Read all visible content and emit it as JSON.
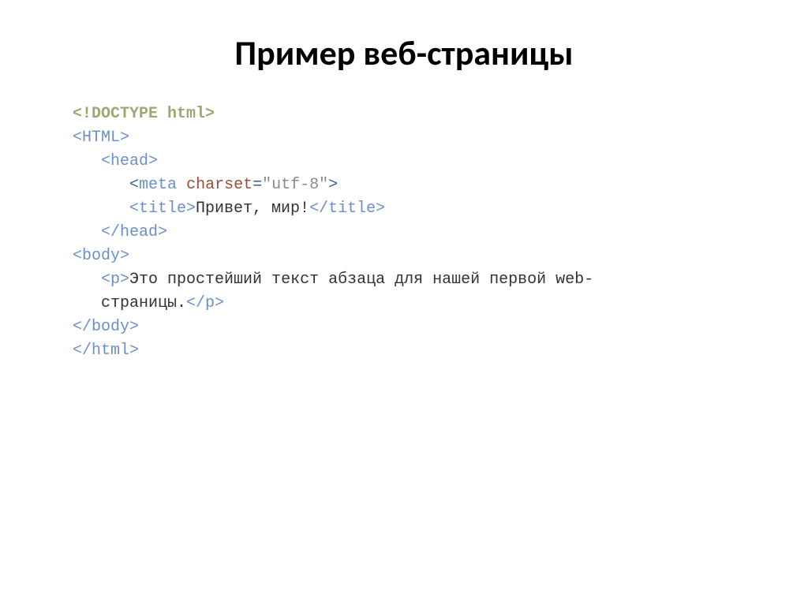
{
  "title": "Пример веб-страницы",
  "code": {
    "doctype": "<!DOCTYPE html>",
    "open_html": "<HTML>",
    "open_head": "<head>",
    "meta_lt": "<",
    "meta_name": "meta",
    "meta_sp": " ",
    "meta_attr": "charset",
    "meta_eq": "=",
    "meta_val": "\"utf-8\"",
    "meta_gt": ">",
    "title_open": "<title>",
    "title_text": "Привет, мир!",
    "title_close": "</title>",
    "close_head": "</head>",
    "open_body": "<body>",
    "p_open": "<p>",
    "p_text1": "Это простейший текст абзаца для нашей первой web-",
    "p_text2": "страницы.",
    "p_close": "</p>",
    "close_body": "</body>",
    "close_html": "</html>"
  }
}
